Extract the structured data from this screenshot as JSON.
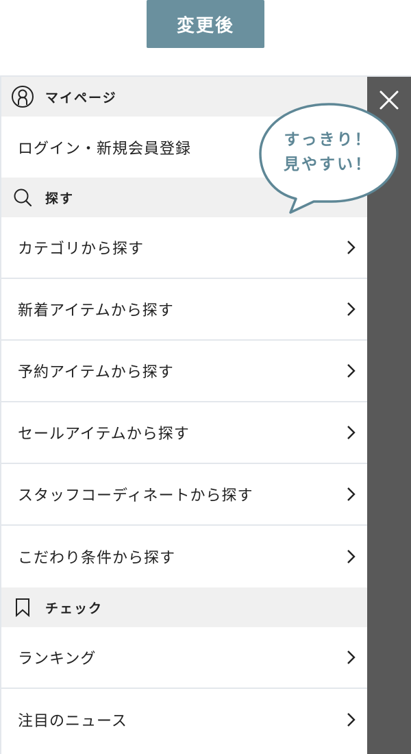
{
  "header": {
    "badge_label": "変更後"
  },
  "menu": {
    "mypage": {
      "title": "マイページ",
      "icon": "user-icon",
      "login_label": "ログイン・新規会員登録"
    },
    "search": {
      "title": "探す",
      "icon": "search-icon",
      "items": [
        {
          "label": "カテゴリから探す"
        },
        {
          "label": "新着アイテムから探す"
        },
        {
          "label": "予約アイテムから探す"
        },
        {
          "label": "セールアイテムから探す"
        },
        {
          "label": "スタッフコーディネートから探す"
        },
        {
          "label": "こだわり条件から探す"
        }
      ]
    },
    "check": {
      "title": "チェック",
      "icon": "bookmark-icon",
      "items": [
        {
          "label": "ランキング"
        },
        {
          "label": "注目のニュース"
        }
      ]
    }
  },
  "overlay": {
    "close_icon": "close-icon"
  },
  "callout": {
    "line1": "すっきり！",
    "line2": "見やすい！"
  },
  "colors": {
    "accent": "#6a909e",
    "overlay": "#595959",
    "section_bg": "#f0f0f0",
    "divider": "#e3e7ec",
    "callout_text": "#5e8796"
  }
}
